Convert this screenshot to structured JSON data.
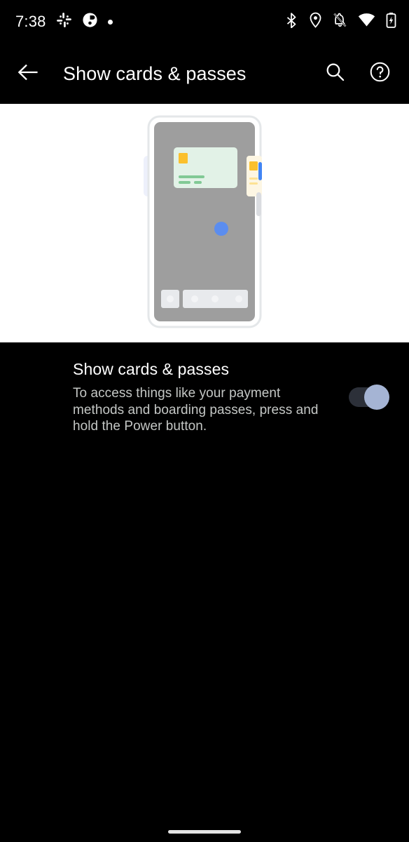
{
  "status_bar": {
    "time": "7:38",
    "left_icons": [
      "slack-icon",
      "app-badge-icon",
      "notification-dot-icon"
    ],
    "right_icons": [
      "bluetooth-icon",
      "location-icon",
      "notifications-muted-icon",
      "wifi-icon",
      "battery-charging-icon"
    ]
  },
  "app_bar": {
    "back_label": "Back",
    "title": "Show cards & passes",
    "search_label": "Search",
    "help_label": "Help"
  },
  "illustration": {
    "alt": "Phone showing cards and passes opened with the Power button",
    "colors": {
      "phone_frame": "#eceff1",
      "phone_screen": "#9e9e9e",
      "green_card": "#e2f2e7",
      "green_card_chip": "#fbc02d",
      "green_card_lines": "#81c995",
      "yellow_card": "#fdf6e3",
      "yellow_card_chip": "#fbc02d",
      "lavender_card": "#edf0fb",
      "power_button": "#4285f4",
      "pointer_dot": "#5b8def",
      "nav_chip": "#e8eaed"
    }
  },
  "setting": {
    "title": "Show cards & passes",
    "description": "To access things like your payment methods and boarding passes, press and hold the Power button.",
    "toggle_state": "on",
    "toggle_accent": "#a5b4d4",
    "toggle_track": "#2c3039"
  },
  "navigation": {
    "gesture_pill": "home-gesture-pill"
  }
}
